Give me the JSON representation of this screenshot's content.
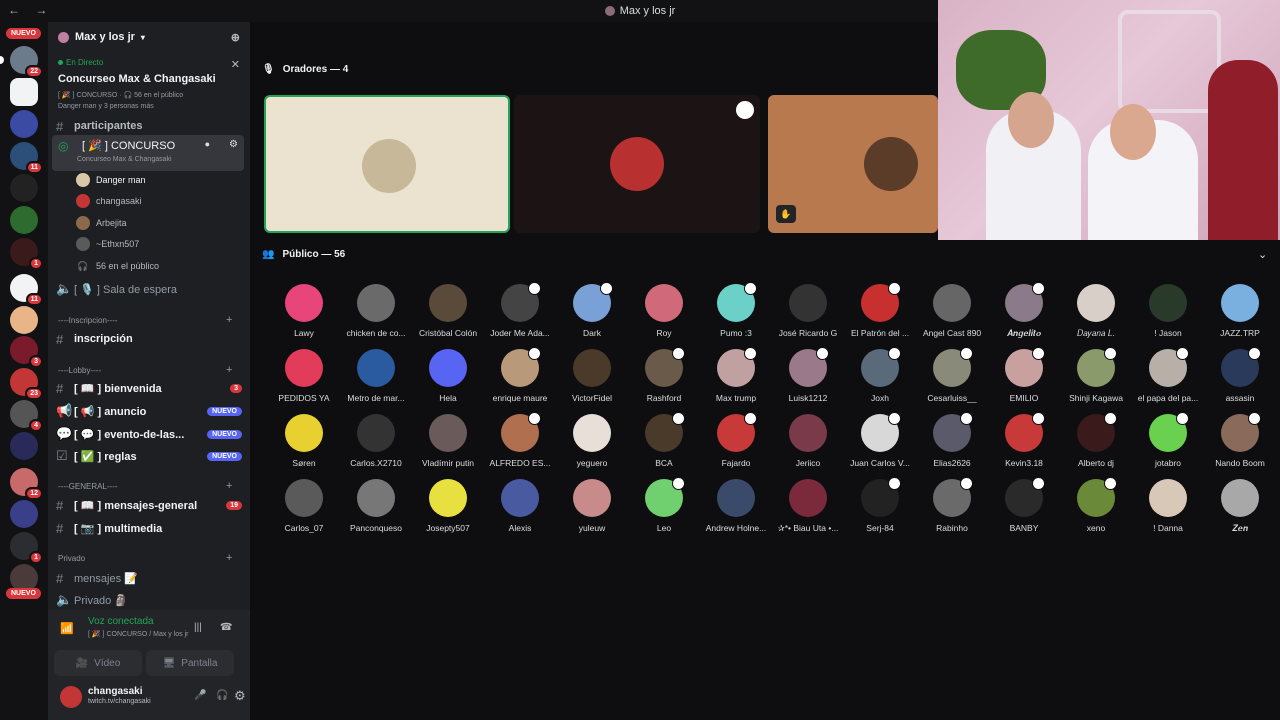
{
  "titlebar": {
    "title": "Max y los jr",
    "nav": "← →"
  },
  "servers": {
    "nuevo_top": "NUEVO",
    "nuevo_bottom": "NUEVO",
    "badges": [
      "22",
      "11",
      "1",
      "11",
      "3",
      "23",
      "4",
      "12",
      "1"
    ]
  },
  "guild": {
    "name": "Max y los jr"
  },
  "live": {
    "status": "En Directo",
    "title": "Concurseo Max & Changasaki",
    "line1": "[ 🎉 ] CONCURSO · 🎧 56 en el público",
    "line2": "Danger man y 3 personas más"
  },
  "channels": {
    "partial": "participantes",
    "stage": {
      "name": "[ 🎉 ] CONCURSO",
      "sub": "Concurseo Max & Changasaki"
    },
    "members": [
      "Danger man",
      "changasaki",
      "Arbejita",
      "~Ethxn507",
      "56 en el público"
    ],
    "waiting": "[ 🎙️ ] Sala de espera",
    "cat_inscripcion": "----Inscripcion----",
    "inscripcion": "inscripción",
    "cat_lobby": "----Lobby----",
    "bienvenida": "[ 📖 ] bienvenida",
    "bienvenida_count": "3",
    "anuncio": "[ 📢 ] anuncio",
    "evento": "[ 💬 ] evento-de-las...",
    "reglas": "[ ✅ ] reglas",
    "nuevo": "NUEVO",
    "cat_general": "----GENERAL----",
    "mensajes": "[ 📖 ] mensajes-general",
    "mensajes_count": "19",
    "multimedia": "[ 📷 ] multimedia",
    "cat_privado": "Privado",
    "priv1": "mensajes 📝",
    "priv2": "Privado 🗿"
  },
  "voice": {
    "status": "Voz conectada",
    "sub": "[ 🎉 ] CONCURSO / Max y los jr",
    "video": "Vídeo",
    "screen": "Pantalla"
  },
  "user": {
    "name": "changasaki",
    "status": "twitch.tv/changasaki"
  },
  "stage": {
    "speakers_header": "Oradores — 4",
    "audience_header": "Público — 56"
  },
  "audience": [
    "Lawy",
    "chicken de co...",
    "Cristóbal Colón",
    "Joder Me Ada...",
    "Dark",
    "Roy",
    "Pumo :3",
    "José Ricardo G",
    "El Patrón del ...",
    "Angel Cast 890",
    "𝑨𝒏𝒈𝒆𝒍𝒊𝒕𝒐",
    "𝐷𝑎𝑦𝑎𝑛𝑎 𝐿.",
    "! Jason",
    "JAZZ.TRP",
    "PEDIDOS YA",
    "Metro de mar...",
    "Hela",
    "enrique maure",
    "VictorFidel",
    "Rashford",
    "Max trump",
    "Luisk1212",
    "Joxh",
    "Cesarluiss__",
    "EMILIO",
    "Shinji Kagawa",
    "el papa del pa...",
    "assasin",
    "Søren",
    "Carlos.X2710",
    "Vladímir putin",
    "ALFREDO ES...",
    "yeguero",
    "BCA",
    "Fajardo",
    "Jeriico",
    "Juan Carlos V...",
    "Elias2626",
    "Kevin3.18",
    "Alberto dj",
    "jotabro",
    "Nando Boom",
    "Carlos_07",
    "Panconqueso",
    "Josepty507",
    "Alexis",
    "yuleuw",
    "Leo",
    "Andrew Holne...",
    "✰*• Biau Uta •...",
    "Serj-84",
    "Rabinho",
    "BANBY",
    "xeno",
    "! Danna",
    "𝒁𝒆𝒏"
  ],
  "colors": {
    "accent": "#5865f2",
    "live": "#23a559",
    "alert": "#da373c"
  }
}
